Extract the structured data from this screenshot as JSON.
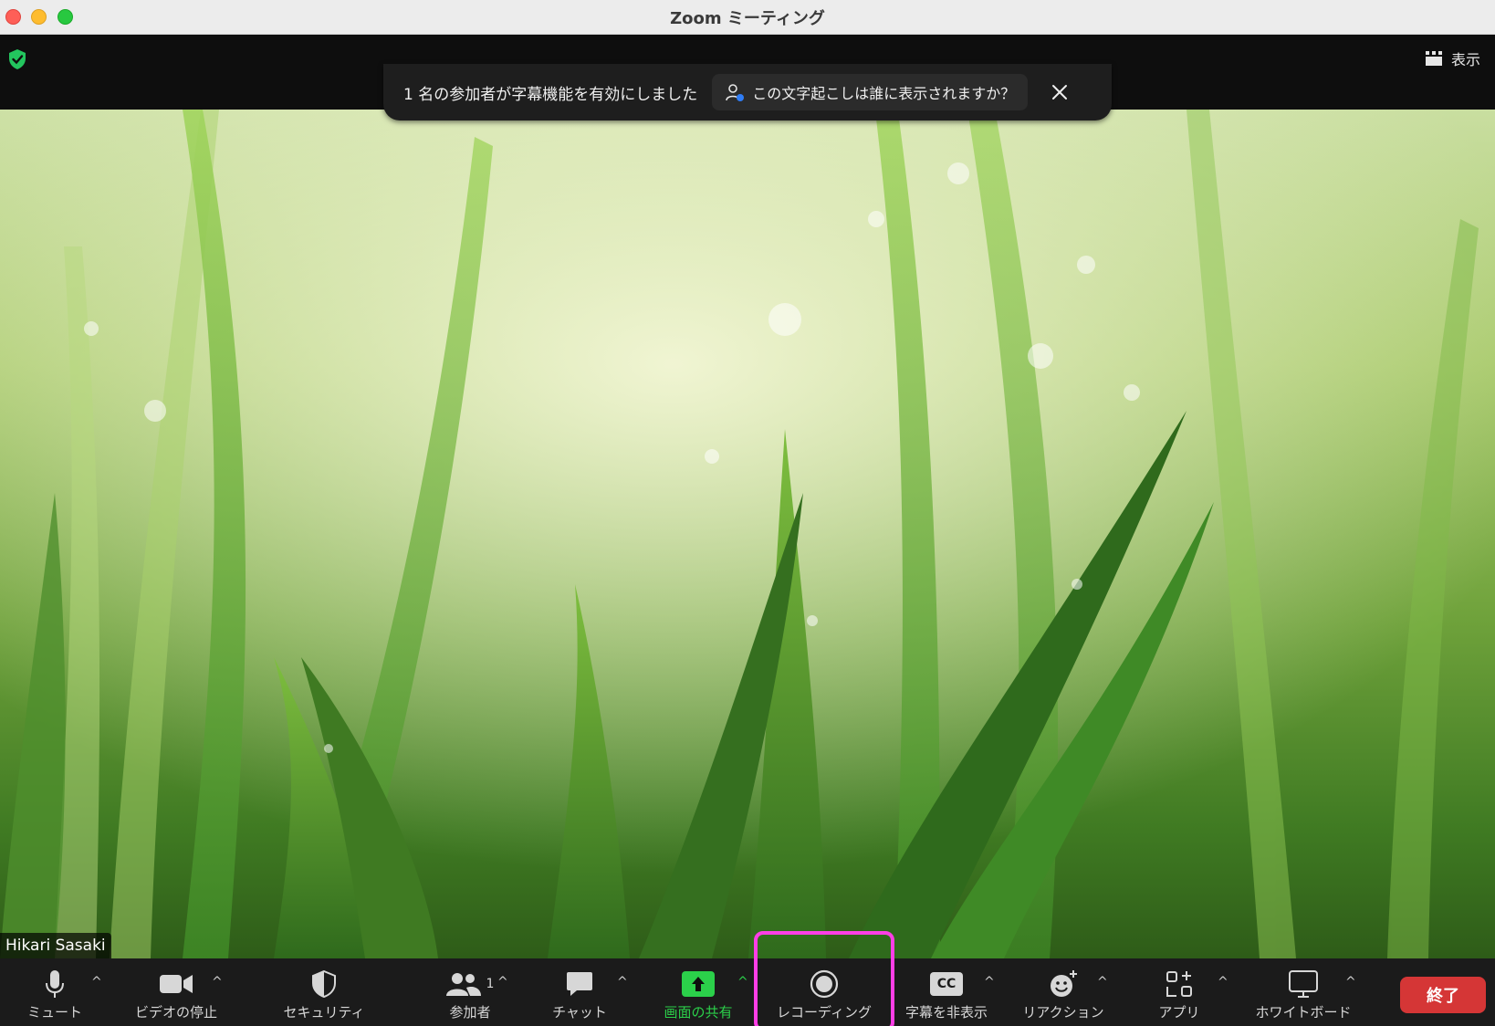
{
  "window": {
    "title": "Zoom ミーティング"
  },
  "topbar": {
    "view_label": "表示"
  },
  "banner": {
    "message": "1 名の参加者が字幕機能を有効にしました",
    "link_text": "この文字起こしは誰に表示されますか？"
  },
  "video": {
    "participant_name": "Hikari Sasaki"
  },
  "toolbar": {
    "mute": "ミュート",
    "video_stop": "ビデオの停止",
    "security": "セキュリティ",
    "participants": "参加者",
    "participants_count": "1",
    "chat": "チャット",
    "share": "画面の共有",
    "record": "レコーディング",
    "captions": "字幕を非表示",
    "captions_badge": "CC",
    "reactions": "リアクション",
    "apps": "アプリ",
    "whiteboard": "ホワイトボード",
    "end": "終了"
  },
  "colors": {
    "share_green": "#2bd04a",
    "end_red": "#d53636",
    "highlight_magenta": "#ff3ee6",
    "shield_green": "#23c55e"
  }
}
